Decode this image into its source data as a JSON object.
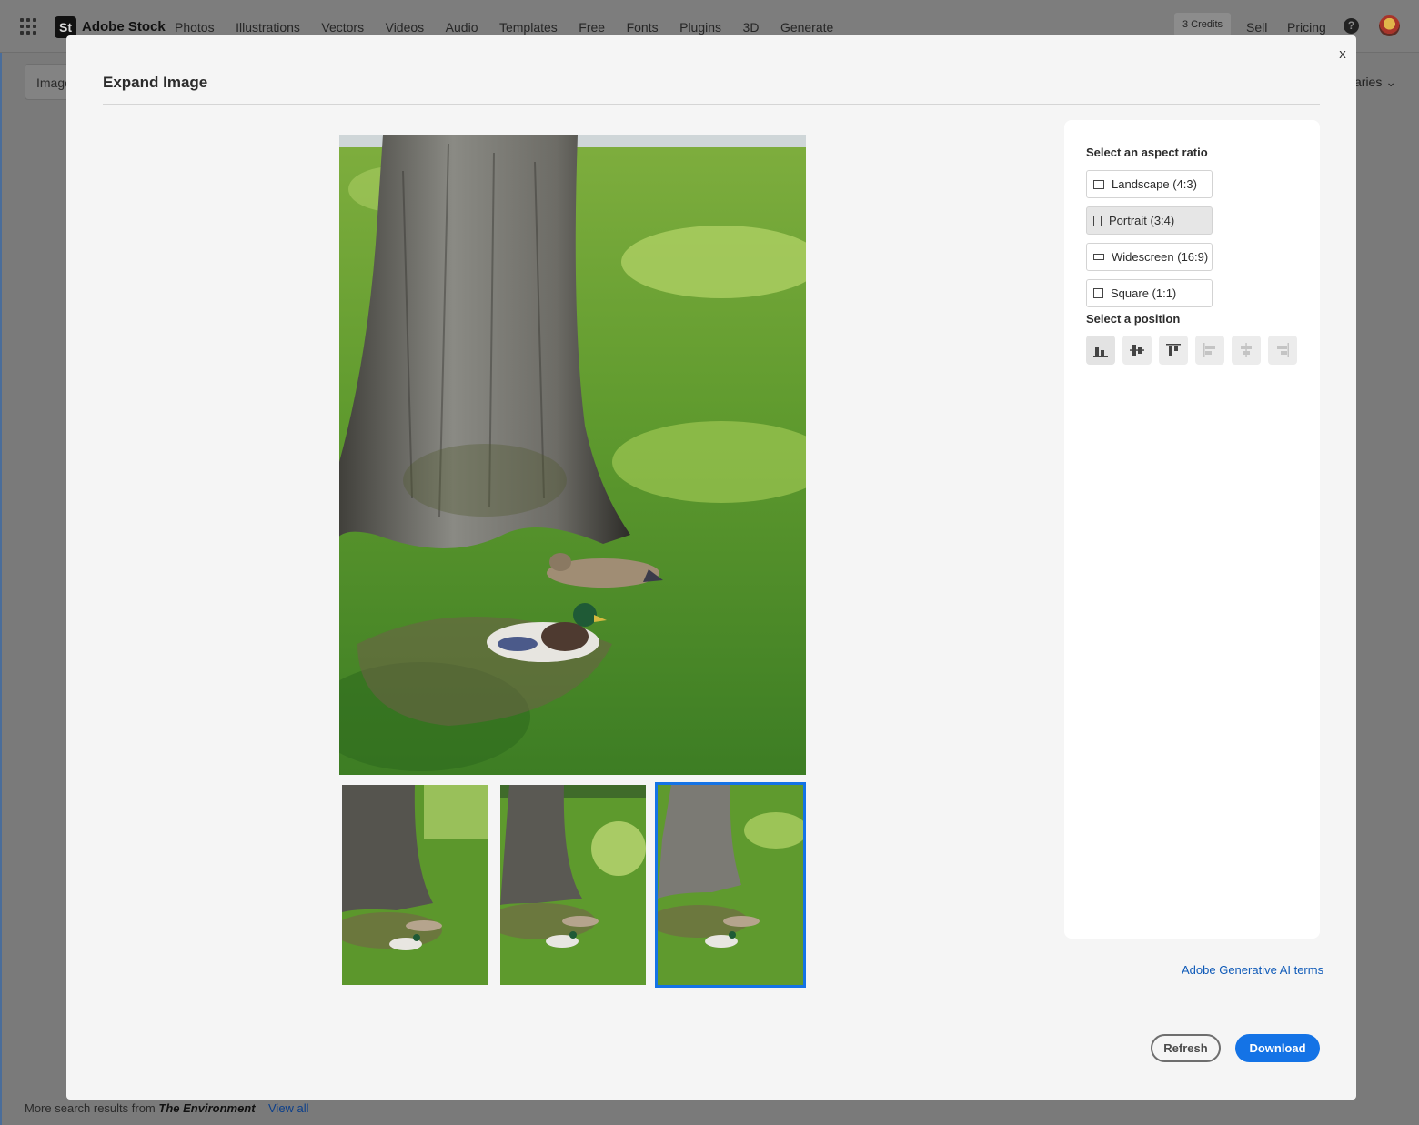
{
  "app": {
    "brand": "Adobe Stock",
    "logo_text": "St",
    "nav": [
      "Photos",
      "Illustrations",
      "Vectors",
      "Videos",
      "Audio",
      "Templates",
      "Free",
      "Fonts",
      "Plugins",
      "3D",
      "Generate"
    ],
    "credits": "3 Credits",
    "sell": "Sell",
    "pricing": "Pricing",
    "search_tab": "Image",
    "libraries": "aries",
    "footer_prefix": "More search results from",
    "footer_source": "The Environment",
    "footer_link": "View all"
  },
  "modal": {
    "title": "Expand Image",
    "close": "x",
    "aspect_label": "Select an aspect ratio",
    "ratios": [
      {
        "label": "Landscape (4:3)",
        "selected": false
      },
      {
        "label": "Portrait (3:4)",
        "selected": true
      },
      {
        "label": "Widescreen (16:9)",
        "selected": false
      },
      {
        "label": "Square (1:1)",
        "selected": false
      }
    ],
    "position_label": "Select a position",
    "positions": [
      "align-bottom-icon",
      "align-middle-icon",
      "align-top-icon",
      "align-left-icon",
      "align-center-icon",
      "align-right-icon"
    ],
    "selected_position": 0,
    "selected_thumbnail": 2,
    "terms_link": "Adobe Generative AI terms",
    "refresh": "Refresh",
    "download": "Download"
  },
  "colors": {
    "accent": "#1473e6",
    "link": "#0f5ab8"
  }
}
